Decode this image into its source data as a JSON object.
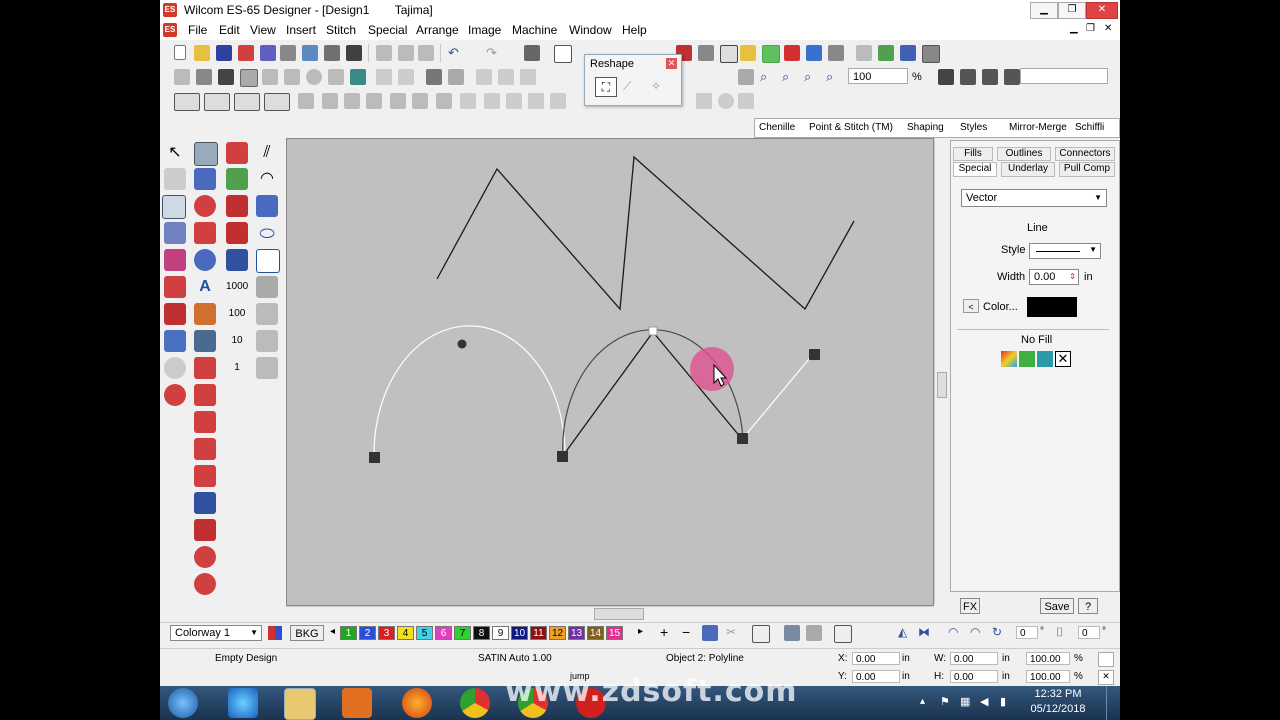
{
  "window": {
    "title": "Wilcom ES-65 Designer - [Design1",
    "title_suffix": "Tajima]",
    "logo": "ES",
    "controls": [
      "minimize-icon",
      "maximize-icon",
      "close-icon"
    ]
  },
  "menubar": {
    "items": [
      "File",
      "Edit",
      "View",
      "Insert",
      "Stitch",
      "Special",
      "Arrange",
      "Image",
      "Machine",
      "Window",
      "Help"
    ]
  },
  "toolbar": {
    "zoom_value": "100",
    "zoom_unit": "%"
  },
  "reshape_panel": {
    "title": "Reshape"
  },
  "docker_tabs": [
    "Chenille",
    "Point & Stitch (TM)",
    "Shaping",
    "Styles",
    "Mirror-Merge",
    "Schiffli"
  ],
  "properties": {
    "tabs_row1": [
      "Fills",
      "Outlines",
      "Connectors"
    ],
    "tabs_row2": [
      "Special",
      "Underlay",
      "Pull Comp"
    ],
    "type_select": "Vector",
    "line_heading": "Line",
    "style_label": "Style",
    "width_label": "Width",
    "width_value": "0.00",
    "width_unit": "in",
    "color_label": "Color...",
    "color_value": "#000000",
    "nofill_label": "No Fill",
    "fx_label": "FX",
    "save_label": "Save",
    "help_label": "?"
  },
  "colorbar": {
    "colorway": "Colorway 1",
    "bkg": "BKG",
    "swatches": [
      {
        "n": "1",
        "color": "#1fa81f",
        "text": "#fff"
      },
      {
        "n": "2",
        "color": "#2850d8",
        "text": "#fff"
      },
      {
        "n": "3",
        "color": "#d82020",
        "text": "#fff"
      },
      {
        "n": "4",
        "color": "#f0e020",
        "text": "#000"
      },
      {
        "n": "5",
        "color": "#40d0e8",
        "text": "#000"
      },
      {
        "n": "6",
        "color": "#e040c0",
        "text": "#fff"
      },
      {
        "n": "7",
        "color": "#30d030",
        "text": "#000"
      },
      {
        "n": "8",
        "color": "#101010",
        "text": "#fff"
      },
      {
        "n": "9",
        "color": "#ffffff",
        "text": "#000"
      },
      {
        "n": "10",
        "color": "#101880",
        "text": "#fff"
      },
      {
        "n": "11",
        "color": "#901010",
        "text": "#fff"
      },
      {
        "n": "12",
        "color": "#f0a020",
        "text": "#000"
      },
      {
        "n": "13",
        "color": "#7030a0",
        "text": "#fff"
      },
      {
        "n": "14",
        "color": "#806020",
        "text": "#fff"
      },
      {
        "n": "15",
        "color": "#e03090",
        "text": "#fff"
      }
    ],
    "angle_value": "0",
    "angle_unit": "°",
    "angle_value2": "0",
    "angle_unit2": "°"
  },
  "status": {
    "design": "Empty Design",
    "stitch": "SATIN Auto  1.00",
    "object": "Object 2: Polyline",
    "hint": "jump",
    "x_label": "X:",
    "x_value": "0.00",
    "x_unit": "in",
    "y_label": "Y:",
    "y_value": "0.00",
    "y_unit": "in",
    "w_label": "W:",
    "w_value": "0.00",
    "w_unit": "in",
    "h_label": "H:",
    "h_value": "0.00",
    "h_unit": "in",
    "w_pct": "100.00",
    "h_pct": "100.00",
    "pct": "%"
  },
  "taskbar": {
    "time": "12:32 PM",
    "date": "05/12/2018",
    "watermark": "www.zdsoft.com"
  }
}
